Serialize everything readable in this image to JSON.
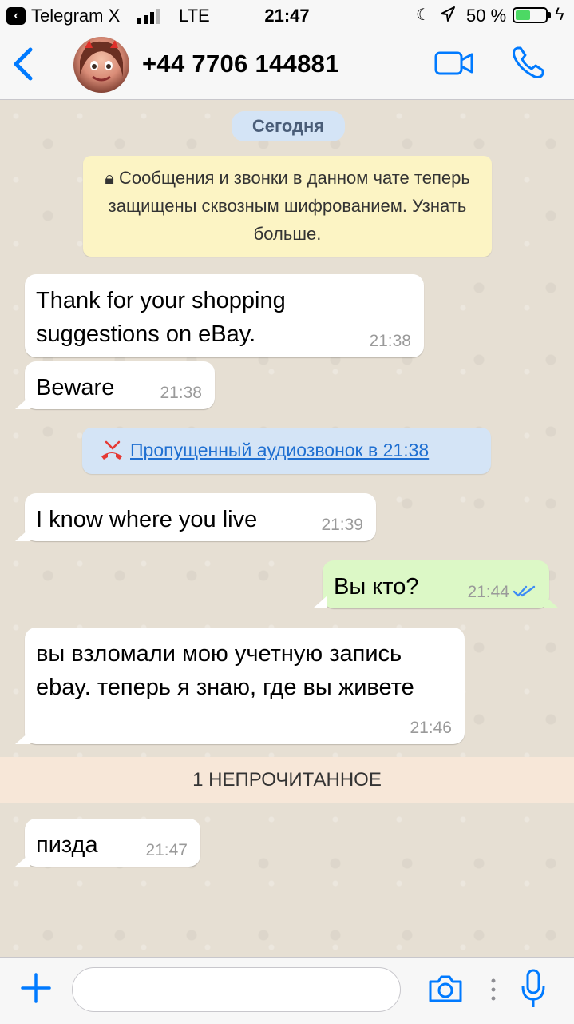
{
  "status_bar": {
    "carrier": "Telegram X",
    "network": "LTE",
    "time": "21:47",
    "battery_percent": "50 %",
    "battery_level": 0.5
  },
  "header": {
    "contact_name": "+44 7706 144881",
    "icons": [
      "back-chevron-icon",
      "video-call-icon",
      "phone-call-icon"
    ],
    "accent_color": "#007aff"
  },
  "chat": {
    "date_label": "Сегодня",
    "encryption_notice": "Сообщения и звонки в данном чате теперь защищены сквозным шифрованием. Узнать больше.",
    "missed_call": "Пропущенный аудиозвонок в 21:38",
    "unread_separator": "1 НЕПРОЧИТАННОЕ",
    "messages": [
      {
        "text": "Thank for your shopping suggestions on eBay.",
        "time": "21:38",
        "direction": "in"
      },
      {
        "text": "Beware",
        "time": "21:38",
        "direction": "in"
      },
      {
        "text": "I know where you live",
        "time": "21:39",
        "direction": "in"
      },
      {
        "text": "Вы кто?",
        "time": "21:44",
        "direction": "out"
      },
      {
        "text": "вы взломали мою учетную запись ebay. теперь я знаю, где вы живете",
        "time": "21:46",
        "direction": "in"
      },
      {
        "text": "пизда",
        "time": "21:47",
        "direction": "in"
      }
    ]
  },
  "input_bar": {
    "message_value": "",
    "icons": [
      "plus-icon",
      "camera-icon",
      "more-dots-icon",
      "microphone-icon"
    ]
  }
}
